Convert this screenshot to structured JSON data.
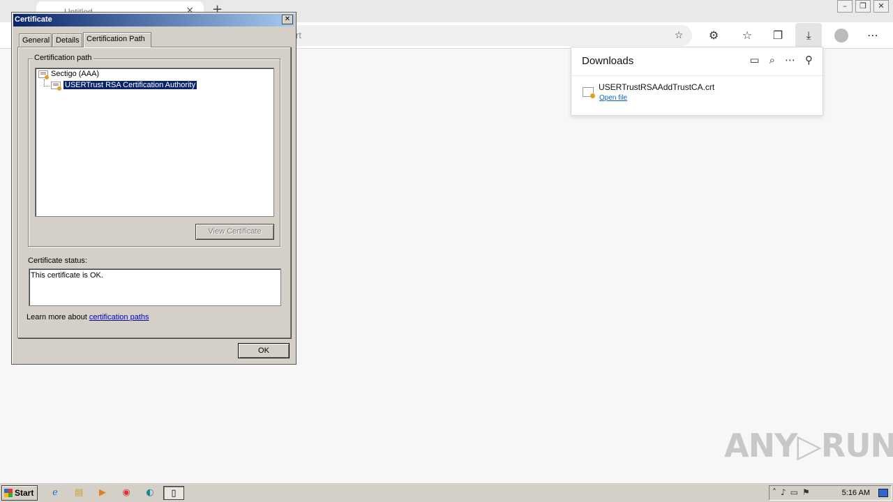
{
  "browser": {
    "tab_title": "Untitled",
    "tab_close": "×",
    "new_tab": "+",
    "address_text": "rt",
    "window_buttons": [
      "–",
      "❐",
      "✕"
    ]
  },
  "downloads": {
    "title": "Downloads",
    "file_name": "USERTrustRSAAddTrustCA.crt",
    "open_file": "Open file"
  },
  "dialog": {
    "title": "Certificate",
    "close": "✕",
    "tabs": [
      "General",
      "Details",
      "Certification Path"
    ],
    "active_tab": "Certification Path",
    "path_group_label": "Certification path",
    "tree": [
      {
        "label": "Sectigo (AAA)",
        "selected": false
      },
      {
        "label": "USERTrust RSA Certification Authority",
        "selected": true
      }
    ],
    "view_certificate": "View Certificate",
    "status_label": "Certificate status:",
    "status_text": "This certificate is OK.",
    "learn_prefix": "Learn more about ",
    "learn_link": "certification paths",
    "ok": "OK"
  },
  "watermark": "ANY▷RUN",
  "taskbar": {
    "start": "Start",
    "clock": "5:16 AM"
  }
}
